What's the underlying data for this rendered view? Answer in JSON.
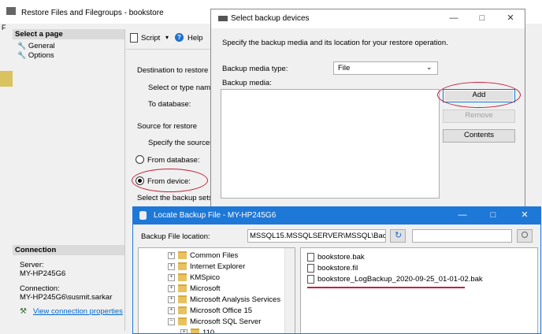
{
  "main_window": {
    "title": "Restore Files and Filegroups - bookstore",
    "sidebar_header": "Select a page",
    "pages": [
      "General",
      "Options"
    ],
    "toolbar": {
      "script": "Script",
      "help": "Help"
    },
    "destination_heading": "Destination to restore",
    "select_or_type": "Select or type name o",
    "to_database": "To database:",
    "source_heading": "Source for restore",
    "specify_sources": "Specify the sources a",
    "from_database": "From database:",
    "from_device": "From device:",
    "select_backup_sets": "Select the backup sets to",
    "connection_header": "Connection",
    "server_label": "Server:",
    "server_value": "MY-HP245G6",
    "connection_label": "Connection:",
    "connection_value": "MY-HP245G6\\susmit.sarkar",
    "view_connection": "View connection properties"
  },
  "select_backup_dialog": {
    "title": "Select backup devices",
    "description": "Specify the backup media and its location for your restore operation.",
    "media_type_label": "Backup media type:",
    "media_type_value": "File",
    "media_label": "Backup media:",
    "add_button": "Add",
    "remove_button": "Remove",
    "contents_button": "Contents"
  },
  "locate_dialog": {
    "title": "Locate Backup File - MY-HP245G6",
    "location_label": "Backup File location:",
    "location_value": "MSSQL15.MSSQLSERVER\\MSSQL\\Backup",
    "tree": [
      "Common Files",
      "Internet Explorer",
      "KMSpico",
      "Microsoft",
      "Microsoft Analysis Services",
      "Microsoft Office 15",
      "Microsoft SQL Server",
      "110"
    ],
    "files": [
      "bookstore.bak",
      "bookstore.fil",
      "bookstore_LogBackup_2020-09-25_01-01-02.bak"
    ]
  },
  "colors": {
    "accent": "#0078d7",
    "annotation": "#c4203a",
    "link": "#0066cc"
  }
}
